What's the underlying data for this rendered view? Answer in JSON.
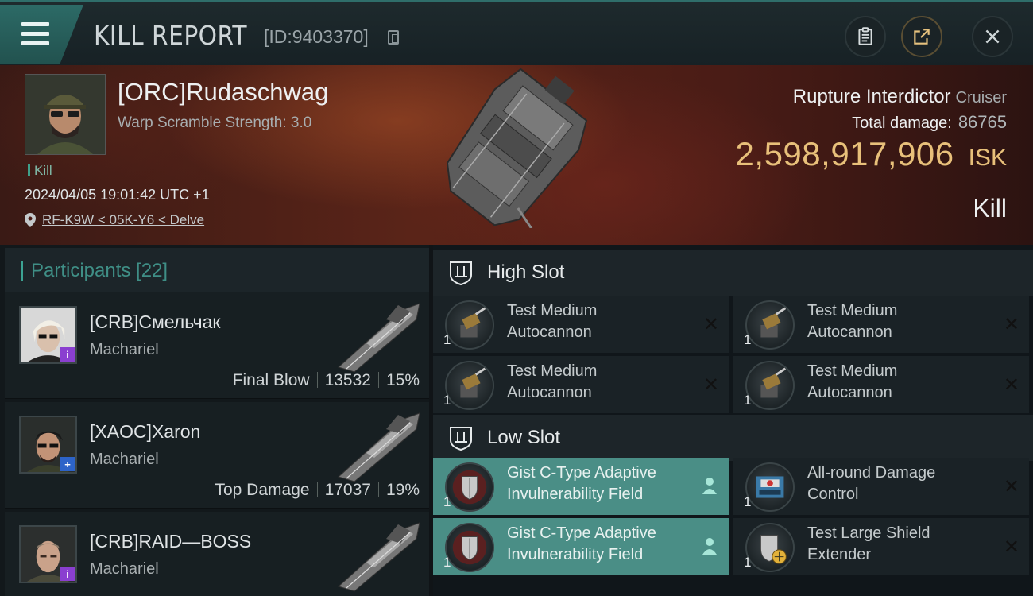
{
  "header": {
    "title": "KILL REPORT",
    "report_id": "[ID:9403370]"
  },
  "victim": {
    "name": "[ORC]Rudaschwag",
    "warp_scramble": "Warp Scramble Strength: 3.0",
    "tag": "Kill",
    "datetime": "2024/04/05 19:01:42 UTC +1",
    "location": "RF-K9W < 05K-Y6 < Delve",
    "ship_name": "Rupture Interdictor",
    "ship_class": "Cruiser",
    "total_damage_label": "Total damage:",
    "total_damage": "86765",
    "isk_value": "2,598,917,906",
    "isk_unit": "ISK",
    "result": "Kill"
  },
  "participants": {
    "label": "Participants [22]",
    "items": [
      {
        "name": "[CRB]Смельчак",
        "ship": "Machariel",
        "role": "Final Blow",
        "damage": "13532",
        "percent": "15%",
        "badge": "i",
        "badge_color": "#8a3fd0"
      },
      {
        "name": "[XAOC]Xaron",
        "ship": "Machariel",
        "role": "Top Damage",
        "damage": "17037",
        "percent": "19%",
        "badge": "+",
        "badge_color": "#2d63c8"
      },
      {
        "name": "[CRB]RAID—BOSS",
        "ship": "Machariel",
        "badge": "i",
        "badge_color": "#8a3fd0"
      }
    ]
  },
  "slots": {
    "high": {
      "label": "High Slot",
      "modules": [
        {
          "qty": "1",
          "name_line1": "Test Medium",
          "name_line2": "Autocannon",
          "state": "destroyed"
        },
        {
          "qty": "1",
          "name_line1": "Test Medium",
          "name_line2": "Autocannon",
          "state": "destroyed"
        },
        {
          "qty": "1",
          "name_line1": "Test Medium",
          "name_line2": "Autocannon",
          "state": "destroyed"
        },
        {
          "qty": "1",
          "name_line1": "Test Medium",
          "name_line2": "Autocannon",
          "state": "destroyed"
        }
      ]
    },
    "low": {
      "label": "Low Slot",
      "modules": [
        {
          "qty": "1",
          "name_line1": "Gist C-Type Adaptive",
          "name_line2": "Invulnerability Field",
          "state": "dropped"
        },
        {
          "qty": "1",
          "name_line1": "All-round Damage",
          "name_line2": "Control",
          "state": "destroyed"
        },
        {
          "qty": "1",
          "name_line1": "Gist C-Type Adaptive",
          "name_line2": "Invulnerability Field",
          "state": "dropped"
        },
        {
          "qty": "1",
          "name_line1": "Test Large Shield",
          "name_line2": "Extender",
          "state": "destroyed"
        }
      ]
    }
  },
  "colors": {
    "accent_teal": "#3ca393",
    "isk_gold": "#e8c07a",
    "dropped_bg": "#4a8e86"
  },
  "icons": [
    "menu-icon",
    "copy-icon",
    "clipboard-icon",
    "share-icon",
    "close-icon",
    "location-pin-icon",
    "shield-slot-icon",
    "person-icon",
    "destroyed-x-icon"
  ]
}
